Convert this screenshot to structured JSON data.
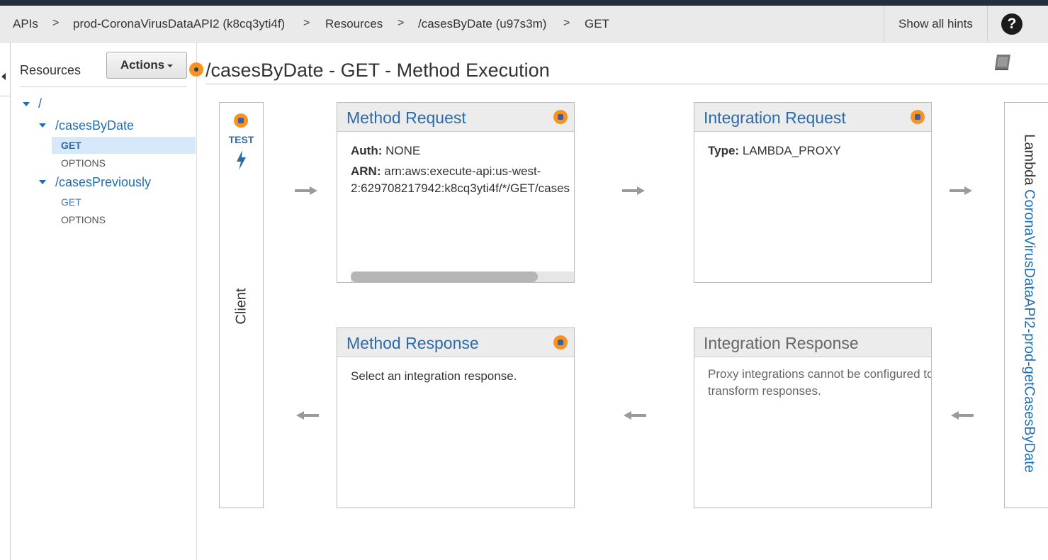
{
  "breadcrumb": {
    "items": [
      "APIs",
      "prod-CoronaVirusDataAPI2 (k8cq3yti4f)",
      "Resources",
      "/casesByDate (u97s3m)",
      "GET"
    ],
    "separator": ">"
  },
  "header": {
    "hints_label": "Show all hints",
    "help_glyph": "?"
  },
  "resources": {
    "title": "Resources",
    "actions_label": "Actions",
    "tree": {
      "root": "/",
      "cases_by_date": {
        "path": "/casesByDate",
        "methods": [
          "GET",
          "OPTIONS"
        ],
        "selected": "GET"
      },
      "cases_previously": {
        "path": "/casesPreviously",
        "methods": [
          "GET",
          "OPTIONS"
        ]
      }
    }
  },
  "main": {
    "title": "/casesByDate - GET - Method Execution",
    "client": {
      "test_label": "TEST",
      "label": "Client"
    },
    "method_request": {
      "title": "Method Request",
      "auth_key": "Auth:",
      "auth_value": "NONE",
      "arn_key": "ARN:",
      "arn_line1": "arn:aws:execute-api:us-west-",
      "arn_line2": "2:629708217942:k8cq3yti4f/*/GET/cases"
    },
    "integration_request": {
      "title": "Integration Request",
      "type_key": "Type:",
      "type_value": "LAMBDA_PROXY"
    },
    "method_response": {
      "title": "Method Response",
      "body": "Select an integration response."
    },
    "integration_response": {
      "title": "Integration Response",
      "body": "Proxy integrations cannot be configured to transform responses."
    },
    "lambda": {
      "prefix": "Lambda",
      "function_name": "CoronaVirusDataAPI2-prod-getCasesByDate"
    }
  },
  "colors": {
    "accent": "#1f6fb5",
    "orange": "#f7931e",
    "topbar": "#232f3e"
  }
}
